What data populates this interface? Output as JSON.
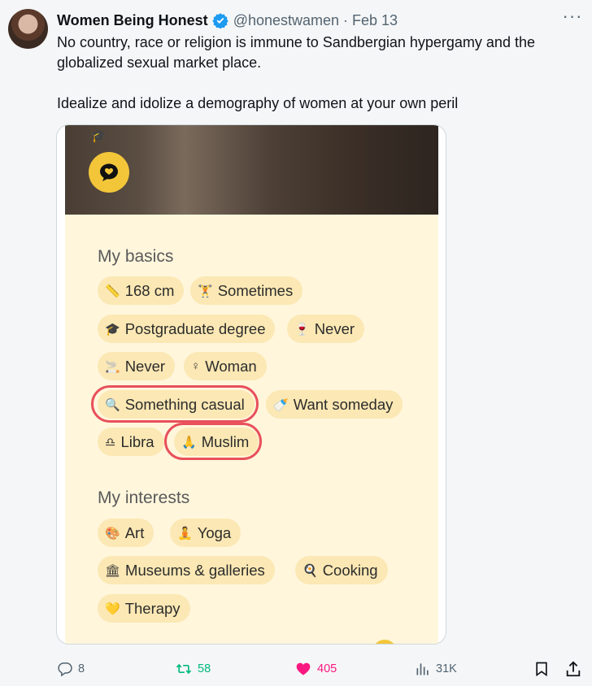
{
  "author": {
    "name": "Women Being Honest",
    "handle": "@honestwamen",
    "separator": "·",
    "date": "Feb 13"
  },
  "more_label": "···",
  "tweet": {
    "line1": "No country, race or religion is immune to Sandbergian hypergamy and the globalized sexual market place.",
    "line2": "Idealize and idolize a demography of women at your own peril"
  },
  "card": {
    "photo_icon": "graduation-cap-icon",
    "basics_title": "My basics",
    "basics": [
      {
        "icon": "📏",
        "label": "168 cm"
      },
      {
        "icon": "🏋",
        "label": "Sometimes"
      },
      {
        "icon": "🎓",
        "label": "Postgraduate degree"
      },
      {
        "icon": "🍷",
        "label": "Never"
      },
      {
        "icon": "🚬",
        "label": "Never"
      },
      {
        "icon": "♀",
        "label": "Woman"
      },
      {
        "icon": "🔍",
        "label": "Something casual"
      },
      {
        "icon": "🍼",
        "label": "Want someday"
      },
      {
        "icon": "♎",
        "label": "Libra"
      },
      {
        "icon": "🙏",
        "label": "Muslim"
      }
    ],
    "interests_title": "My interests",
    "interests": [
      {
        "icon": "🎨",
        "label": "Art"
      },
      {
        "icon": "🧘",
        "label": "Yoga"
      },
      {
        "icon": "🏛",
        "label": "Museums & galleries"
      },
      {
        "icon": "🍳",
        "label": "Cooking"
      },
      {
        "icon": "💛",
        "label": "Therapy"
      }
    ],
    "highlight_color": "#e8505b",
    "chip_color": "#fbe8b4",
    "card_bg": "#fff6dc"
  },
  "actions": {
    "replies": "8",
    "retweets": "58",
    "likes": "405",
    "views": "31K"
  },
  "colors": {
    "retweet": "#00ba7c",
    "like": "#f91880",
    "muted": "#536471"
  }
}
